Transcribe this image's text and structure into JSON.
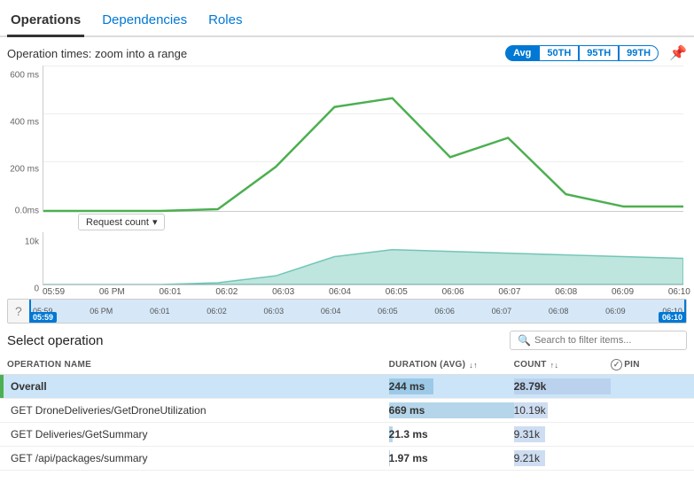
{
  "tabs": [
    {
      "id": "operations",
      "label": "Operations",
      "active": true
    },
    {
      "id": "dependencies",
      "label": "Dependencies",
      "active": false
    },
    {
      "id": "roles",
      "label": "Roles",
      "active": false
    }
  ],
  "chart": {
    "title": "Operation times: zoom into a range",
    "percentiles": [
      "Avg",
      "50TH",
      "95TH",
      "99TH"
    ],
    "active_percentile": "Avg",
    "y_labels": [
      "600 ms",
      "400 ms",
      "200 ms",
      "0.0ms"
    ],
    "x_labels": [
      "05:59",
      "06 PM",
      "06:01",
      "06:02",
      "06:03",
      "06:04",
      "06:05",
      "06:06",
      "06:07",
      "06:08",
      "06:09",
      "06:10"
    ]
  },
  "request_count": {
    "label": "Request count",
    "y_labels": [
      "10k",
      "0"
    ],
    "x_labels": [
      "05:59",
      "06 PM",
      "06:01",
      "06:02",
      "06:03",
      "06:04",
      "06:05",
      "06:06",
      "06:07",
      "06:08",
      "06:09",
      "06:10"
    ]
  },
  "range": {
    "start": "05:59",
    "end": "06:10",
    "x_labels": [
      "05:59",
      "06 PM",
      "06:01",
      "06:02",
      "06:03",
      "06:04",
      "06:05",
      "06:06",
      "06:07",
      "06:08",
      "06:09",
      "06:10"
    ]
  },
  "select_operation": {
    "title": "Select operation",
    "search_placeholder": "Search to filter items...",
    "columns": [
      {
        "id": "name",
        "label": "OPERATION NAME"
      },
      {
        "id": "duration",
        "label": "DURATION (AVG)",
        "sortable": true
      },
      {
        "id": "count",
        "label": "COUNT",
        "sortable": true
      },
      {
        "id": "pin",
        "label": "PIN"
      }
    ],
    "rows": [
      {
        "name": "Overall",
        "duration": "244 ms",
        "count": "28.79k",
        "highlighted": true,
        "duration_pct": 36,
        "count_pct": 100
      },
      {
        "name": "GET DroneDeliveries/GetDroneUtilization",
        "duration": "669 ms",
        "count": "10.19k",
        "highlighted": false,
        "duration_pct": 100,
        "count_pct": 35
      },
      {
        "name": "GET Deliveries/GetSummary",
        "duration": "21.3 ms",
        "count": "9.31k",
        "highlighted": false,
        "duration_pct": 3,
        "count_pct": 32
      },
      {
        "name": "GET /api/packages/summary",
        "duration": "1.97 ms",
        "count": "9.21k",
        "highlighted": false,
        "duration_pct": 0.3,
        "count_pct": 32
      }
    ]
  }
}
